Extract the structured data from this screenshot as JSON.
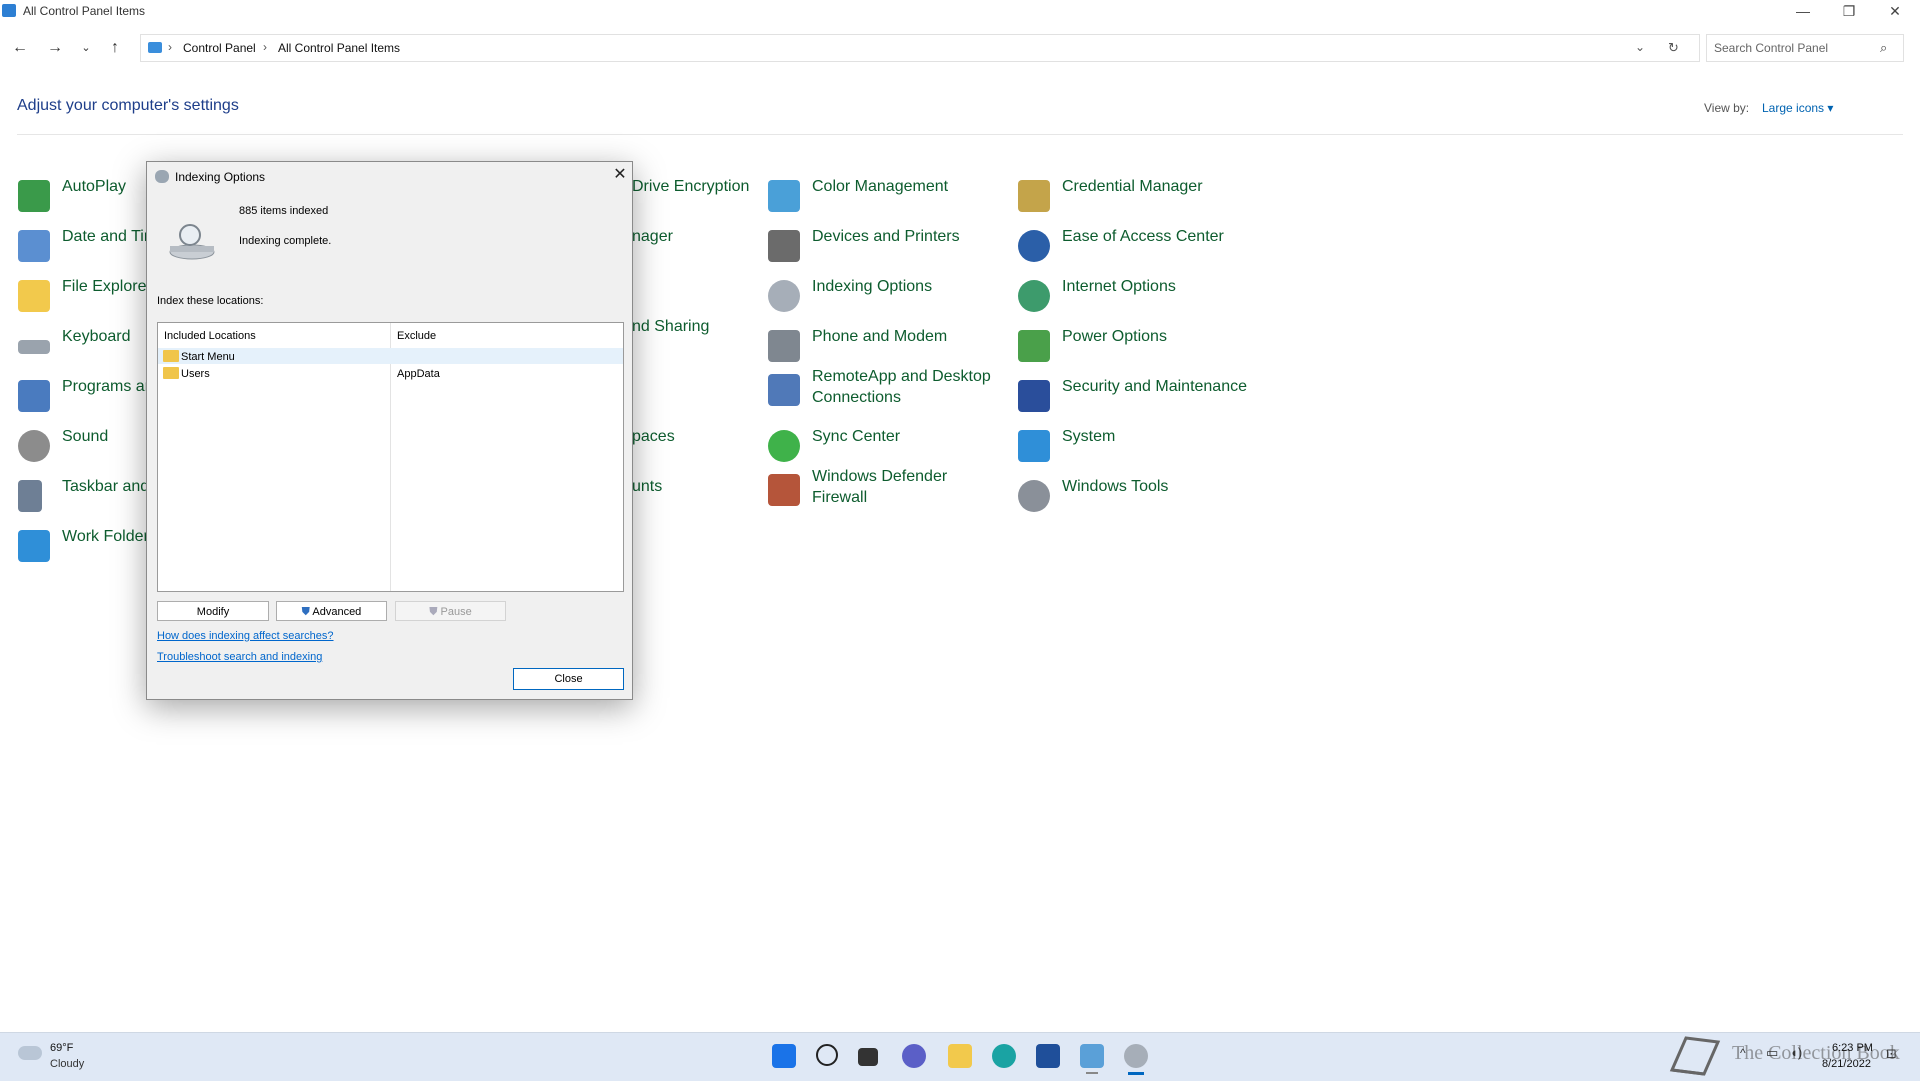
{
  "window": {
    "title": "All Control Panel Items"
  },
  "address": {
    "crumbs": [
      "Control Panel",
      "All Control Panel Items"
    ],
    "search_placeholder": "Search Control Panel"
  },
  "main": {
    "heading": "Adjust your computer's settings",
    "view_by_label": "View by:",
    "view_by_value": "Large icons ▾"
  },
  "items": {
    "col1": [
      "AutoPlay",
      "Date and Tir",
      "File Explorer",
      "Keyboard",
      "Programs ar",
      "Sound",
      "Taskbar and",
      "Work Folder"
    ],
    "col2": [
      "Drive Encryption",
      "nager",
      "nd Sharing",
      "paces",
      "unts"
    ],
    "col3": [
      "Color Management",
      "Devices and Printers",
      "Indexing Options",
      "Phone and Modem",
      "RemoteApp and Desktop",
      "Connections",
      "Sync Center",
      "Windows Defender",
      "Firewall"
    ],
    "col4": [
      "Credential Manager",
      "Ease of Access Center",
      "Internet Options",
      "Power Options",
      "Security and Maintenance",
      "System",
      "Windows Tools"
    ]
  },
  "dialog": {
    "title": "Indexing Options",
    "items_indexed": "885 items indexed",
    "status": "Indexing complete.",
    "locations_label": "Index these locations:",
    "columns": [
      "Included Locations",
      "Exclude"
    ],
    "rows": [
      {
        "location": "Start Menu",
        "exclude": ""
      },
      {
        "location": "Users",
        "exclude": "AppData"
      }
    ],
    "buttons": {
      "modify": "Modify",
      "advanced": "Advanced",
      "pause": "Pause",
      "close": "Close"
    },
    "links": [
      "How does indexing affect searches?",
      "Troubleshoot search and indexing"
    ]
  },
  "taskbar": {
    "weather_temp": "69°F",
    "weather_cond": "Cloudy",
    "time": "6:23 PM",
    "date": "8/21/2022",
    "watermark": "The Collection Book"
  },
  "colors": {
    "link_green": "#0d5c2e",
    "accent_blue": "#0067c0",
    "taskbar": "#dfe8f5"
  }
}
